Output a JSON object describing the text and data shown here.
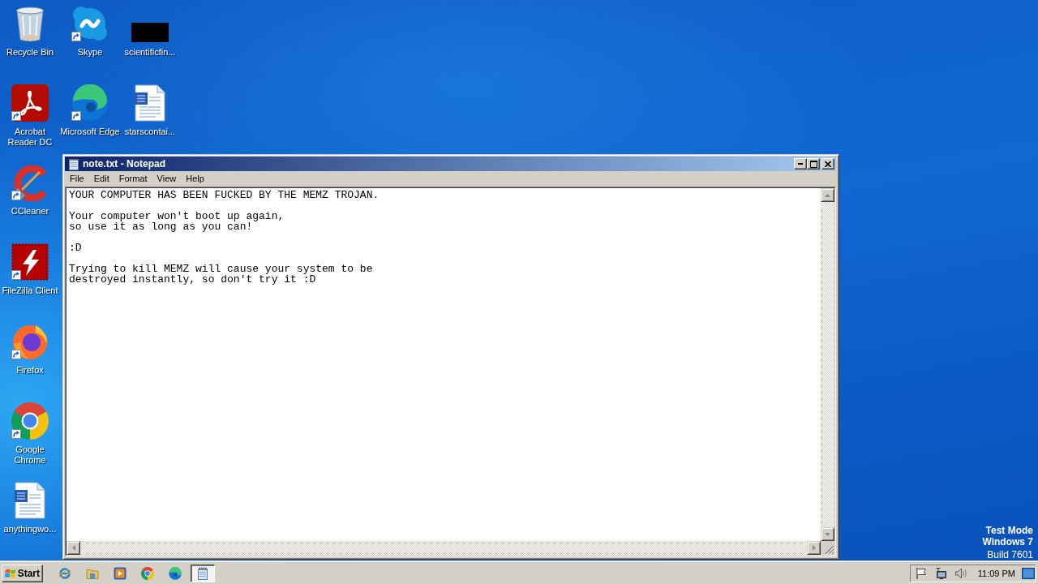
{
  "desktop": {
    "icon_columns": [
      [
        {
          "kind": "recycle-bin",
          "label": "Recycle Bin",
          "shortcut": false
        },
        {
          "kind": "acrobat",
          "label": "Acrobat Reader DC",
          "shortcut": true
        },
        {
          "kind": "ccleaner",
          "label": "CCleaner",
          "shortcut": true
        },
        {
          "kind": "filezilla",
          "label": "FileZilla Client",
          "shortcut": true
        },
        {
          "kind": "firefox",
          "label": "Firefox",
          "shortcut": true
        },
        {
          "kind": "chrome",
          "label": "Google Chrome",
          "shortcut": true
        },
        {
          "kind": "document",
          "label": "anythingwo...",
          "shortcut": false
        }
      ],
      [
        {
          "kind": "skype",
          "label": "Skype",
          "shortcut": true
        },
        {
          "kind": "edge",
          "label": "Microsoft Edge",
          "shortcut": true
        }
      ],
      [
        {
          "kind": "thumbnail",
          "label": "scientificfin...",
          "shortcut": false
        },
        {
          "kind": "document",
          "label": "starscontai...",
          "shortcut": false
        }
      ]
    ],
    "test_mode": {
      "title": "Test Mode",
      "edition": "Windows 7",
      "build": "Build 7601"
    }
  },
  "window": {
    "title": "note.txt - Notepad",
    "active": true,
    "menu": [
      "File",
      "Edit",
      "Format",
      "View",
      "Help"
    ],
    "content": "YOUR COMPUTER HAS BEEN FUCKED BY THE MEMZ TROJAN.\n\nYour computer won't boot up again,\nso use it as long as you can!\n\n:D\n\nTrying to kill MEMZ will cause your system to be\ndestroyed instantly, so don't try it :D"
  },
  "taskbar": {
    "start_label": "Start",
    "quick_launch": [
      {
        "kind": "internet-explorer"
      },
      {
        "kind": "folder"
      },
      {
        "kind": "media-player"
      },
      {
        "kind": "chrome"
      },
      {
        "kind": "edge"
      }
    ],
    "tasks": [
      {
        "kind": "notepad",
        "selected": true
      }
    ],
    "clock": "11:09 PM"
  }
}
